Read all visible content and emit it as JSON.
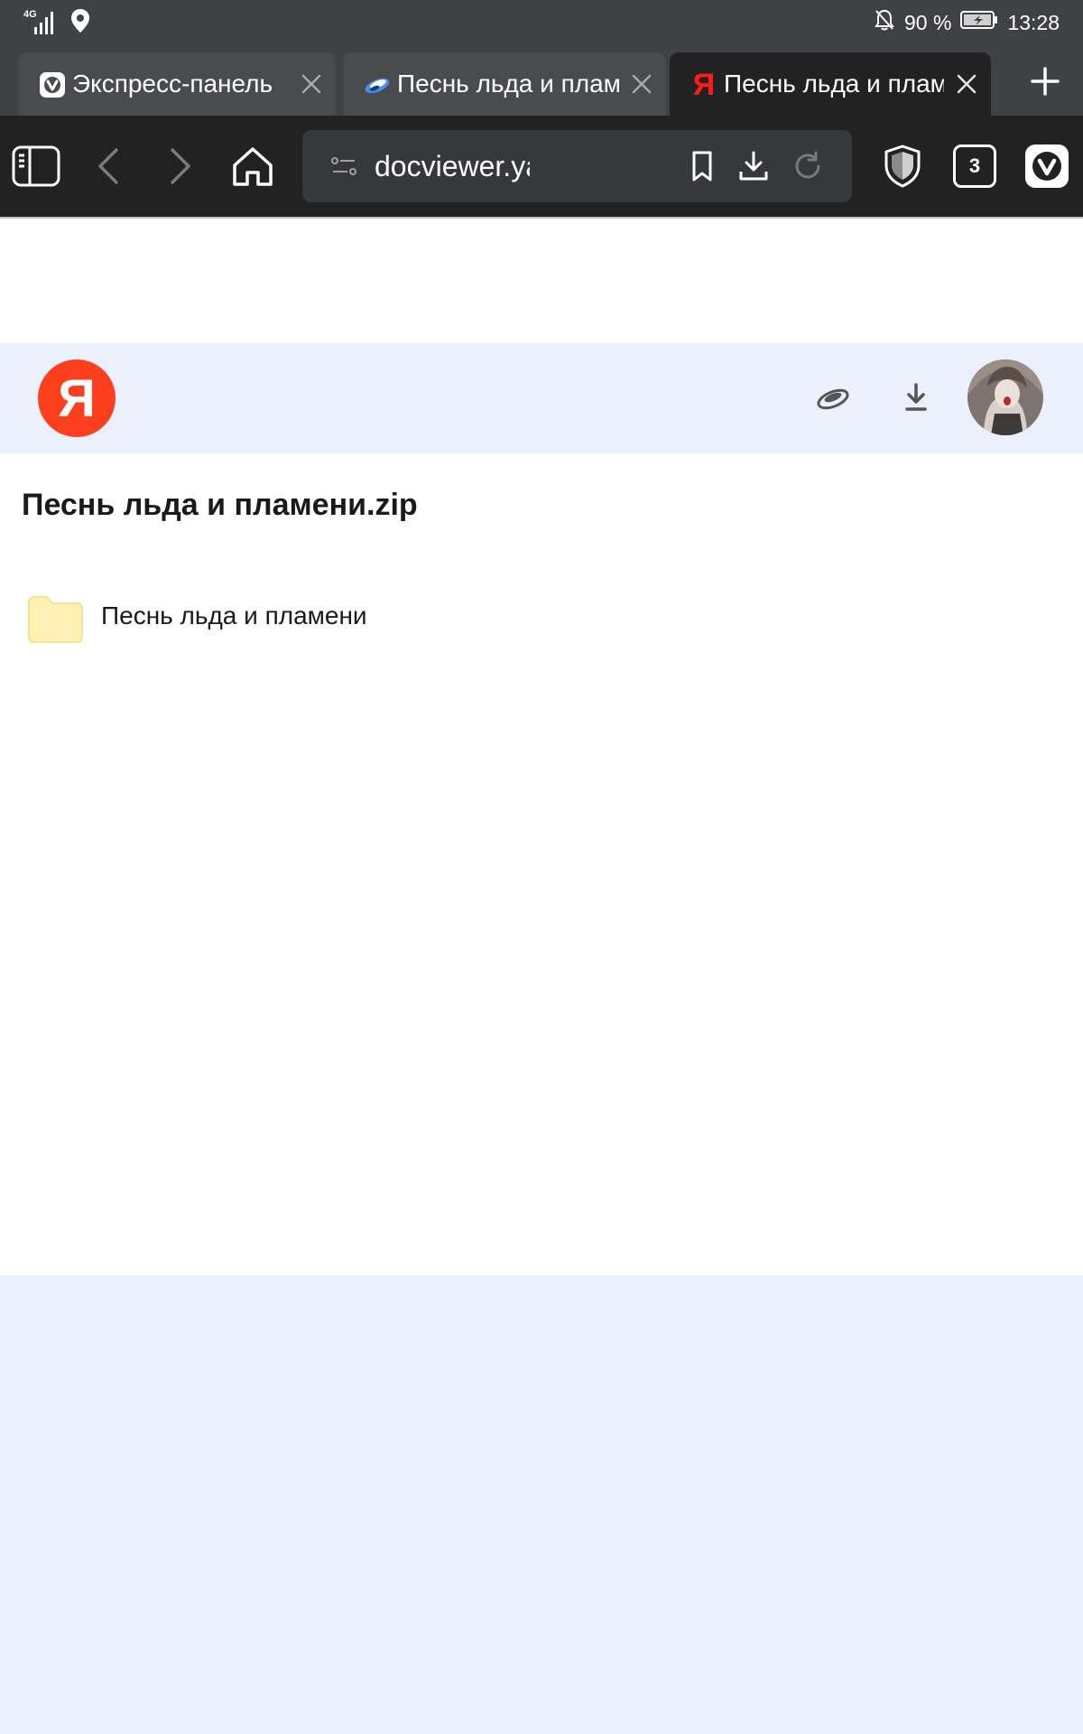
{
  "status_bar": {
    "network": "4G",
    "battery": "90 %",
    "time": "13:28",
    "icons": [
      "signal-icon",
      "location-icon",
      "notifications-off-icon",
      "battery-charging-icon"
    ]
  },
  "tabs": [
    {
      "title": "Экспресс-панель",
      "favicon": "vivaldi-icon",
      "active": false
    },
    {
      "title": "Песнь льда и плам",
      "favicon": "disk-icon",
      "active": false
    },
    {
      "title": "Песнь льда и плам",
      "favicon": "yandex-icon",
      "active": true
    }
  ],
  "toolbar": {
    "url": "docviewer.yandex.ru/vie",
    "tab_count": "3"
  },
  "header": {
    "logo_letter": "Я"
  },
  "page": {
    "title": "Песнь льда и пламени.zip",
    "items": [
      {
        "name": "Песнь льда и пламени",
        "type": "folder"
      }
    ]
  },
  "colors": {
    "header_bg": "#ebf0fd",
    "yandex_red": "#fc3f1d",
    "folder": "#fff1b3",
    "browser_chrome": "#222222"
  }
}
